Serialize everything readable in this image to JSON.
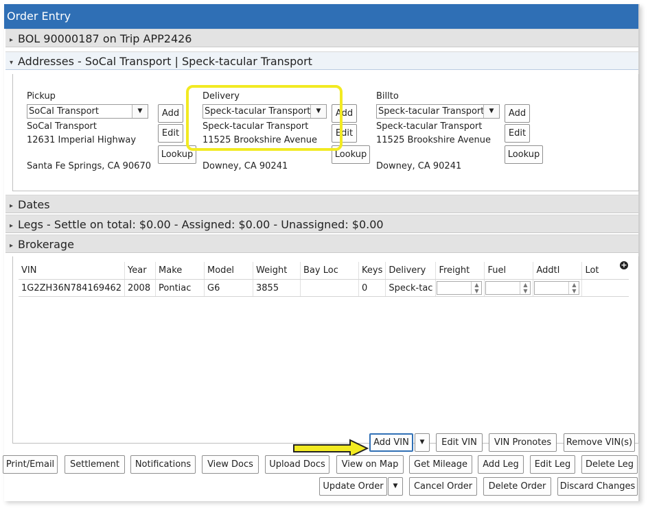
{
  "window": {
    "title": "Order Entry"
  },
  "sections": {
    "bol": "BOL 90000187 on Trip APP2426",
    "addresses": "Addresses - SoCal Transport | Speck-tacular Transport",
    "dates": "Dates",
    "legs": "Legs - Settle on total: $0.00 - Assigned: $0.00 - Unassigned: $0.00",
    "brokerage": "Brokerage"
  },
  "addresses": {
    "pickup": {
      "label": "Pickup",
      "selected": "SoCal Transport",
      "name": "SoCal Transport",
      "street": "12631 Imperial Highway",
      "city": "Santa Fe Springs, CA 90670"
    },
    "delivery": {
      "label": "Delivery",
      "selected": "Speck-tacular Transport",
      "name": "Speck-tacular Transport",
      "street": "11525 Brookshire Avenue",
      "city": "Downey, CA 90241"
    },
    "billto": {
      "label": "Billto",
      "selected": "Speck-tacular Transport",
      "name": "Speck-tacular Transport",
      "street": "11525 Brookshire Avenue",
      "city": "Downey, CA 90241"
    },
    "buttons": {
      "add": "Add",
      "edit": "Edit",
      "lookup": "Lookup"
    }
  },
  "grid": {
    "headers": [
      "VIN",
      "Year",
      "Make",
      "Model",
      "Weight",
      "Bay Loc",
      "Keys",
      "Delivery",
      "Freight",
      "Fuel",
      "Addtl",
      "Lot"
    ],
    "rows": [
      {
        "vin": "1G2ZH36N784169462",
        "year": "2008",
        "make": "Pontiac",
        "model": "G6",
        "weight": "3855",
        "bayloc": "",
        "keys": "0",
        "delivery": "Speck-tac"
      }
    ]
  },
  "vin_buttons": {
    "add_vin": "Add VIN",
    "edit_vin": "Edit VIN",
    "vin_pronotes": "VIN Pronotes",
    "remove_vin": "Remove VIN(s)"
  },
  "action_buttons": {
    "print_email": "Print/Email",
    "settlement": "Settlement",
    "notifications": "Notifications",
    "view_docs": "View Docs",
    "upload_docs": "Upload Docs",
    "view_on_map": "View on Map",
    "get_mileage": "Get Mileage",
    "add_leg": "Add Leg",
    "edit_leg": "Edit Leg",
    "delete_leg": "Delete Leg"
  },
  "order_buttons": {
    "update_order": "Update Order",
    "cancel_order": "Cancel Order",
    "delete_order": "Delete Order",
    "discard_changes": "Discard Changes"
  },
  "icons": {
    "collapsed": "triangle-right-icon",
    "expanded": "triangle-down-icon",
    "dropdown": "dropdown-arrow-icon",
    "add_column": "plus-circle-icon",
    "annotation": "yellow-arrow-icon"
  },
  "colors": {
    "titlebar": "#2f6fb5",
    "highlight": "#f2ea22"
  }
}
